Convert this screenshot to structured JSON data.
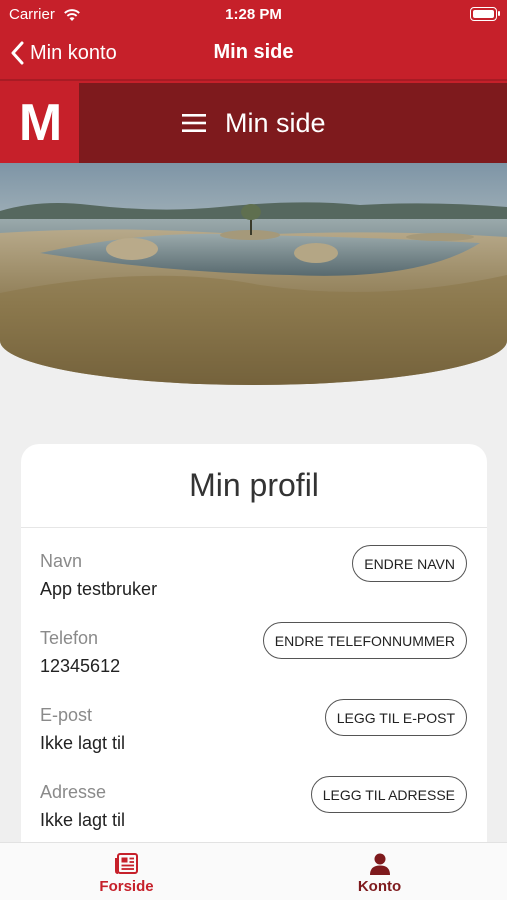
{
  "status_bar": {
    "carrier": "Carrier",
    "time": "1:28 PM"
  },
  "nav_bar": {
    "back_label": "Min konto",
    "title": "Min side"
  },
  "site_header": {
    "logo": "M",
    "menu_label": "Min side"
  },
  "profile": {
    "title": "Min profil",
    "rows": [
      {
        "label": "Navn",
        "value": "App testbruker",
        "button": "ENDRE NAVN"
      },
      {
        "label": "Telefon",
        "value": "12345612",
        "button": "ENDRE TELEFONNUMMER"
      },
      {
        "label": "E-post",
        "value": "Ikke lagt til",
        "button": "LEGG TIL E-POST"
      },
      {
        "label": "Adresse",
        "value": "Ikke lagt til",
        "button": "LEGG TIL ADRESSE"
      }
    ]
  },
  "tab_bar": {
    "tabs": [
      {
        "label": "Forside",
        "icon": "newspaper-icon",
        "active": false
      },
      {
        "label": "Konto",
        "icon": "user-icon",
        "active": true
      }
    ]
  },
  "colors": {
    "brand_red": "#c6202a",
    "dark_red": "#7e1a1d",
    "background": "#efefef"
  }
}
